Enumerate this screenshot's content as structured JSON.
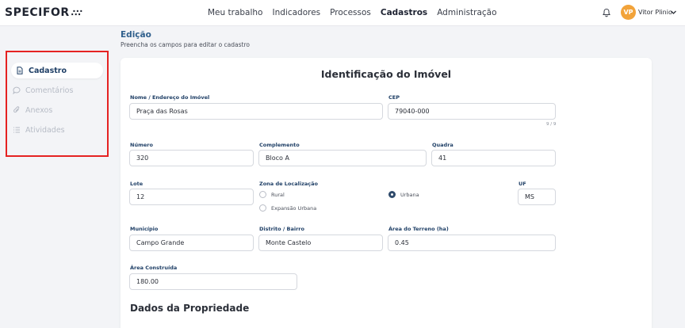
{
  "brand": {
    "name": "SPECIFOR",
    "mark": "∴∵"
  },
  "nav": {
    "items": [
      "Meu trabalho",
      "Indicadores",
      "Processos",
      "Cadastros",
      "Administração"
    ],
    "active": "Cadastros"
  },
  "user": {
    "initials": "VP",
    "name": "Vitor Plinio"
  },
  "page": {
    "title": "Edição",
    "subtitle": "Preencha os campos para editar o cadastro"
  },
  "sidebar": {
    "items": [
      {
        "label": "Cadastro",
        "icon": "document-icon",
        "active": true
      },
      {
        "label": "Comentários",
        "icon": "comment-icon",
        "active": false
      },
      {
        "label": "Anexos",
        "icon": "paperclip-icon",
        "active": false
      },
      {
        "label": "Atividades",
        "icon": "list-icon",
        "active": false
      }
    ]
  },
  "form": {
    "section_title": "Identificação do Imóvel",
    "nome_endereco": {
      "label": "Nome / Endereço do Imóvel",
      "value": "Praça das Rosas"
    },
    "cep": {
      "label": "CEP",
      "value": "79040-000",
      "counter": "9 / 9"
    },
    "numero": {
      "label": "Número",
      "value": "320"
    },
    "complemento": {
      "label": "Complemento",
      "value": "Bloco A"
    },
    "quadra": {
      "label": "Quadra",
      "value": "41"
    },
    "lote": {
      "label": "Lote",
      "value": "12"
    },
    "zona": {
      "label": "Zona de Localização",
      "options": [
        "Rural",
        "Expansão Urbana",
        "Urbana"
      ],
      "selected": "Urbana"
    },
    "uf": {
      "label": "UF",
      "value": "MS"
    },
    "municipio": {
      "label": "Município",
      "value": "Campo Grande"
    },
    "distrito": {
      "label": "Distrito / Bairro",
      "value": "Monte Castelo"
    },
    "area_terreno": {
      "label": "Área do Terreno (ha)",
      "value": "0.45"
    },
    "area_construida": {
      "label": "Área Construída",
      "value": "180.00"
    }
  },
  "section2": {
    "title": "Dados da Propriedade"
  },
  "colors": {
    "accent": "#2f5f8c",
    "highlight_border": "#e52222",
    "avatar": "#f2a33a"
  }
}
